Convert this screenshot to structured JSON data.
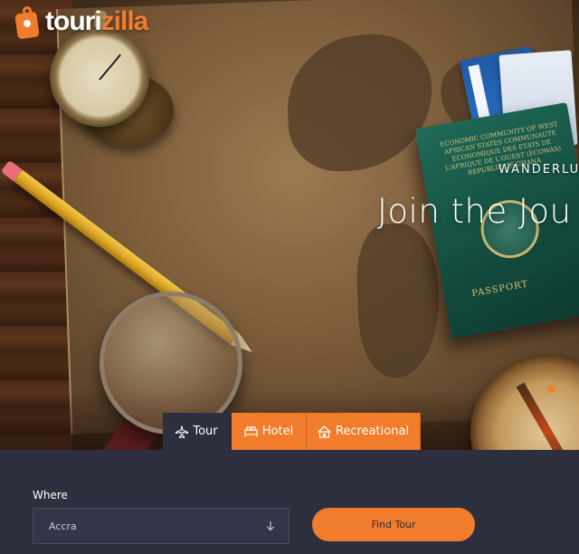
{
  "brand": {
    "logo_part1": "touri",
    "logo_part2": "zilla",
    "accent_color": "#f07c2c",
    "panel_color": "#2d2f3e"
  },
  "hero": {
    "subtitle": "WANDERLU",
    "title": "Join the Jou",
    "passport": {
      "header": "ECONOMIC COMMUNITY OF WEST AFRICAN STATES COMMUNAUTE ECONOMIQUE DES ETATS DE L'AFRIQUE DE L'OUEST (ECOWAS) REPUBLIC OF GHANA",
      "title": "PASSPORT"
    }
  },
  "tabs": [
    {
      "label": "Tour",
      "icon": "plane-icon",
      "active": true
    },
    {
      "label": "Hotel",
      "icon": "bed-icon",
      "active": false
    },
    {
      "label": "Recreational",
      "icon": "tent-icon",
      "active": false
    }
  ],
  "search": {
    "where_label": "Where",
    "where_value": "Accra",
    "submit_label": "Find Tour"
  }
}
